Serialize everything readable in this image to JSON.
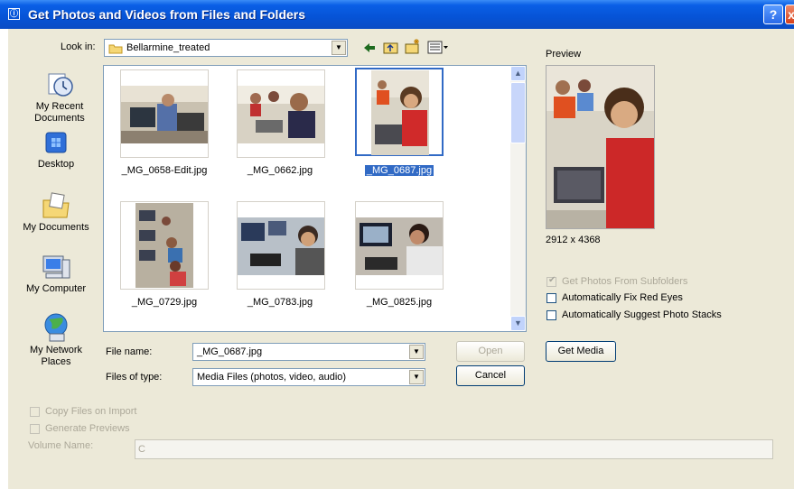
{
  "window": {
    "title": "Get Photos and Videos from Files and Folders",
    "help_label": "?",
    "close_label": "x"
  },
  "toolbar": {
    "look_in_label": "Look in:",
    "look_in_value": "Bellarmine_treated",
    "icons": [
      "back-arrow-icon",
      "up-folder-icon",
      "new-folder-icon",
      "view-menu-icon"
    ]
  },
  "places": [
    {
      "label_line1": "My Recent",
      "label_line2": "Documents",
      "icon": "recent-documents-icon"
    },
    {
      "label_line1": "Desktop",
      "label_line2": "",
      "icon": "desktop-icon"
    },
    {
      "label_line1": "My Documents",
      "label_line2": "",
      "icon": "my-documents-icon"
    },
    {
      "label_line1": "My Computer",
      "label_line2": "",
      "icon": "my-computer-icon"
    },
    {
      "label_line1": "My Network",
      "label_line2": "Places",
      "icon": "network-places-icon"
    }
  ],
  "files": [
    {
      "name": "_MG_0658-Edit.jpg",
      "selected": false,
      "orientation": "landscape"
    },
    {
      "name": "_MG_0662.jpg",
      "selected": false,
      "orientation": "landscape"
    },
    {
      "name": "_MG_0687.jpg",
      "selected": true,
      "orientation": "portrait"
    },
    {
      "name": "_MG_0729.jpg",
      "selected": false,
      "orientation": "portrait"
    },
    {
      "name": "_MG_0783.jpg",
      "selected": false,
      "orientation": "landscape"
    },
    {
      "name": "_MG_0825.jpg",
      "selected": false,
      "orientation": "landscape"
    }
  ],
  "preview": {
    "label": "Preview",
    "dimensions": "2912 x 4368"
  },
  "options": {
    "subfolders": {
      "label": "Get Photos From Subfolders",
      "checked": true,
      "enabled": false
    },
    "red_eye": {
      "label": "Automatically Fix Red Eyes",
      "checked": false,
      "enabled": true
    },
    "photo_stacks": {
      "label": "Automatically Suggest Photo Stacks",
      "checked": false,
      "enabled": true
    }
  },
  "form": {
    "file_name_label": "File name:",
    "file_name_value": "_MG_0687.jpg",
    "file_type_label": "Files of type:",
    "file_type_value": "Media Files (photos, video, audio)",
    "open_label": "Open",
    "cancel_label": "Cancel",
    "get_media_label": "Get Media"
  },
  "import": {
    "copy_files_label": "Copy Files on Import",
    "generate_previews_label": "Generate Previews",
    "volume_name_label": "Volume Name:",
    "volume_name_value": "C"
  },
  "colors": {
    "title_bar": "#0653d6",
    "dialog_bg": "#ece9d8",
    "selection": "#316ac5"
  }
}
